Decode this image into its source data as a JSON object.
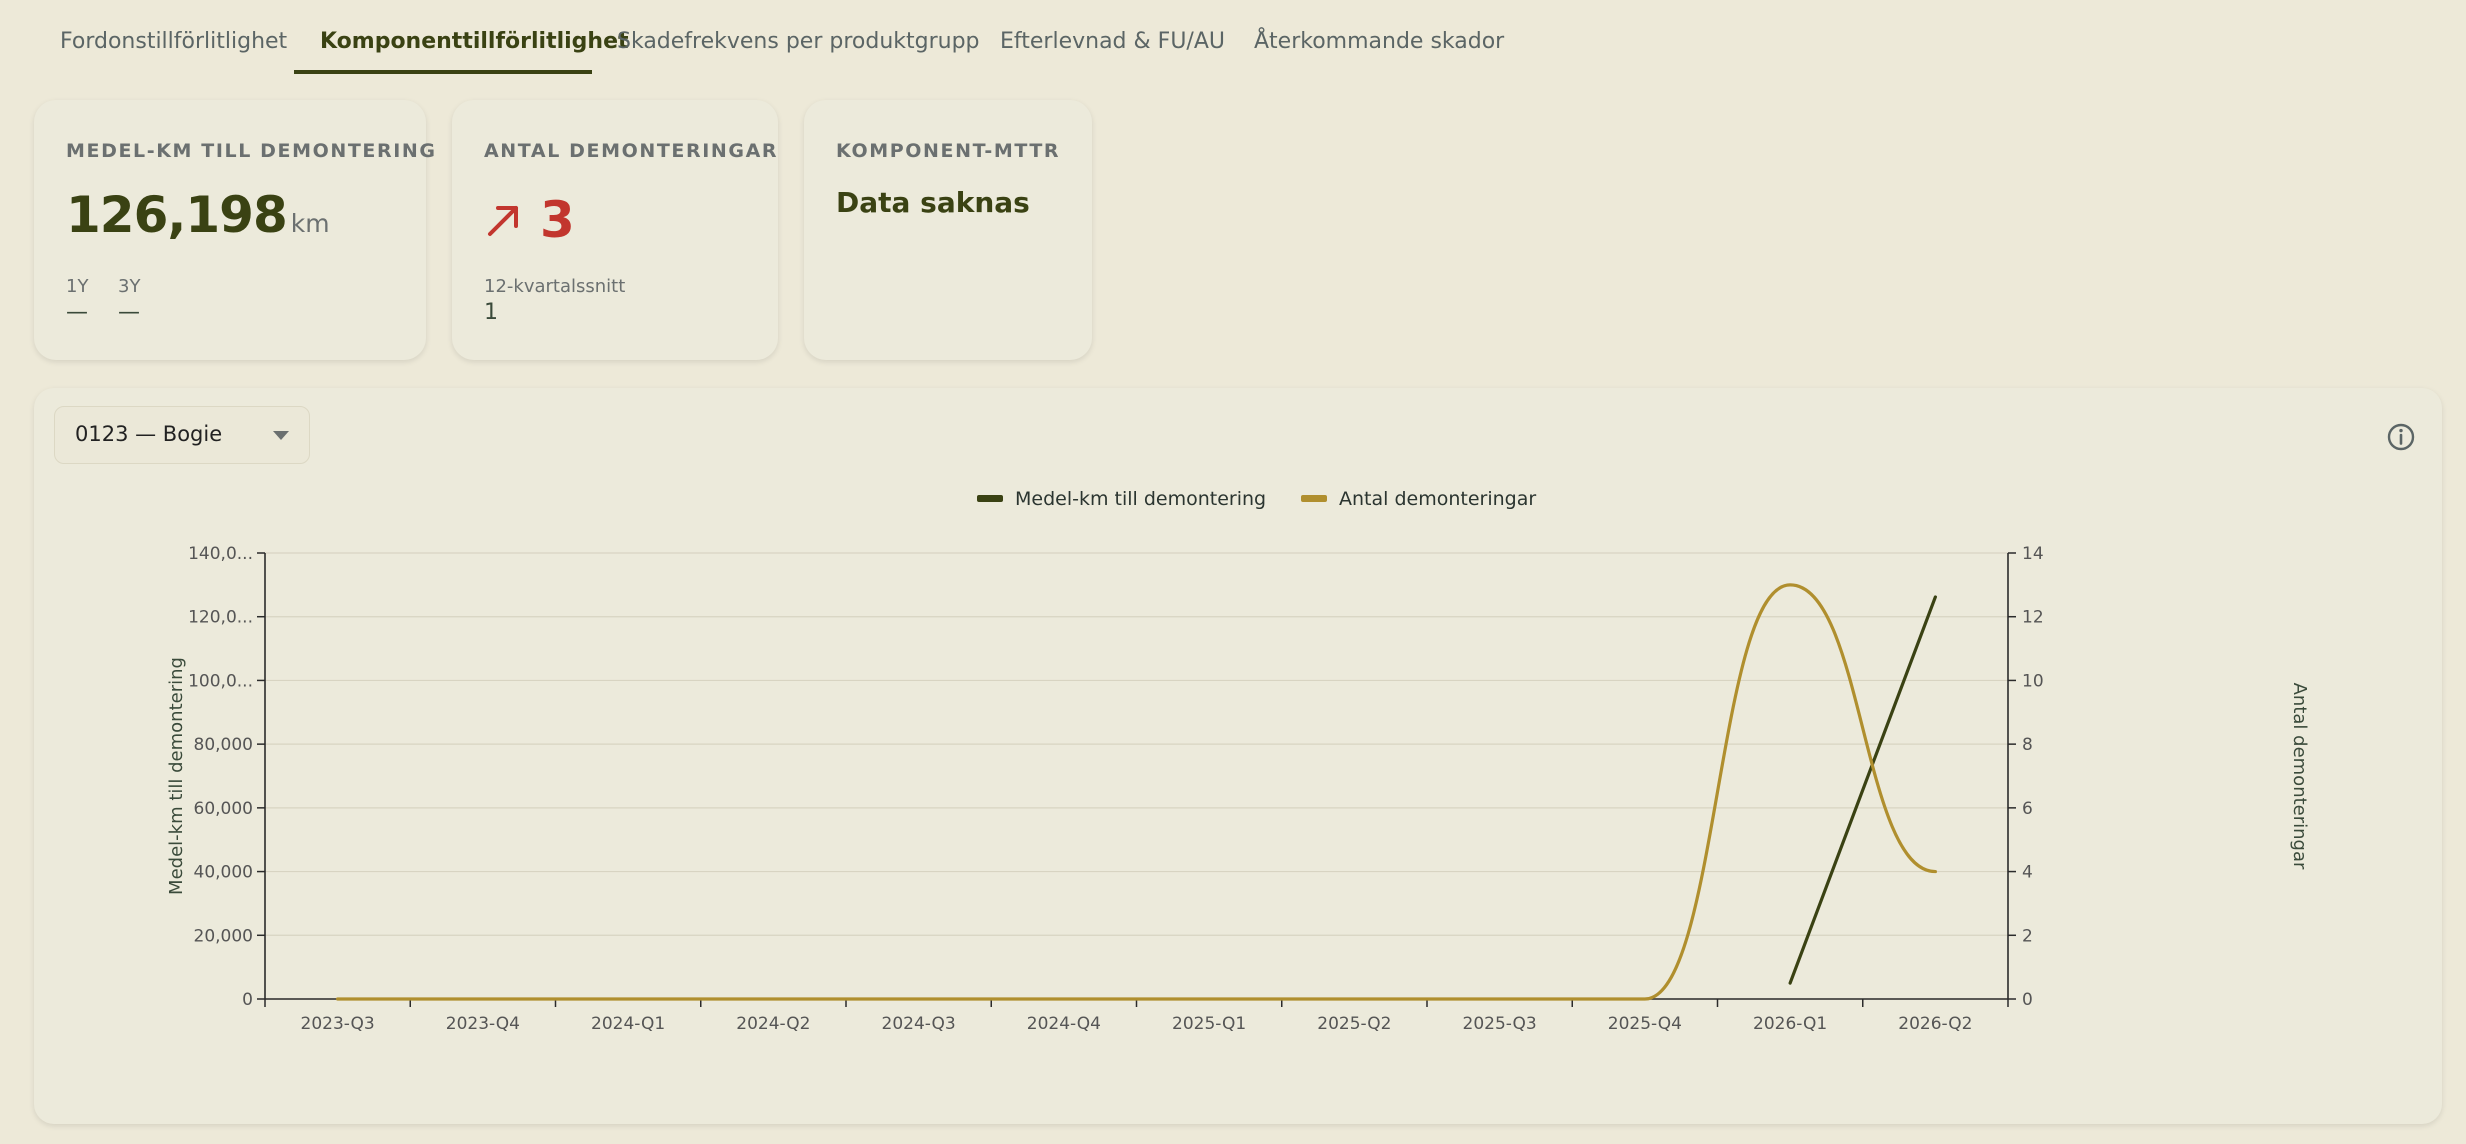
{
  "tabs": [
    {
      "label": "Fordonstillförlitlighet",
      "active": false
    },
    {
      "label": "Komponenttillförlitlighet",
      "active": true
    },
    {
      "label": "Skadefrekvens per produktgrupp",
      "active": false
    },
    {
      "label": "Efterlevnad & FU/AU",
      "active": false
    },
    {
      "label": "Återkommande skador",
      "active": false
    }
  ],
  "kpi_km": {
    "title": "MEDEL-KM TILL DEMONTERING",
    "value": "126,198",
    "unit": "km",
    "sub1_label": "1Y",
    "sub1_value": "—",
    "sub2_label": "3Y",
    "sub2_value": "—"
  },
  "kpi_count": {
    "title": "ANTAL DEMONTERINGAR",
    "trend_icon": "arrow-up-right-icon",
    "value": "3",
    "sub_label": "12-kvartalssnitt",
    "sub_value": "1"
  },
  "kpi_mttr": {
    "title": "KOMPONENT-MTTR",
    "value": "Data saknas"
  },
  "selector": {
    "value": "0123 — Bogie"
  },
  "colors": {
    "series_km": "#3a4213",
    "series_count": "#b08f2e",
    "trend_red": "#c2362e",
    "grid": "#d8d4c2",
    "axis": "#2b2b2b"
  },
  "chart_data": {
    "type": "line",
    "categories": [
      "2023-Q3",
      "2023-Q4",
      "2024-Q1",
      "2024-Q2",
      "2024-Q3",
      "2024-Q4",
      "2025-Q1",
      "2025-Q2",
      "2025-Q3",
      "2025-Q4",
      "2026-Q1",
      "2026-Q2"
    ],
    "series": [
      {
        "name": "Medel-km till demontering",
        "axis": "left",
        "values": [
          null,
          null,
          null,
          null,
          null,
          null,
          null,
          null,
          null,
          null,
          5000,
          126198
        ]
      },
      {
        "name": "Antal demonteringar",
        "axis": "right",
        "smooth": true,
        "values": [
          0,
          0,
          0,
          0,
          0,
          0,
          0,
          0,
          0,
          0,
          13,
          4
        ]
      }
    ],
    "ylabel": "Medel-km till demontering",
    "y2label": "Antal demonteringar",
    "ylim": [
      0,
      140000
    ],
    "y2lim": [
      0,
      14
    ],
    "yticks": [
      "0",
      "20,000",
      "40,000",
      "60,000",
      "80,000",
      "100,0...",
      "120,0...",
      "140,0..."
    ],
    "y2ticks": [
      "0",
      "2",
      "4",
      "6",
      "8",
      "10",
      "12",
      "14"
    ],
    "legend": "top-center",
    "grid": true
  }
}
